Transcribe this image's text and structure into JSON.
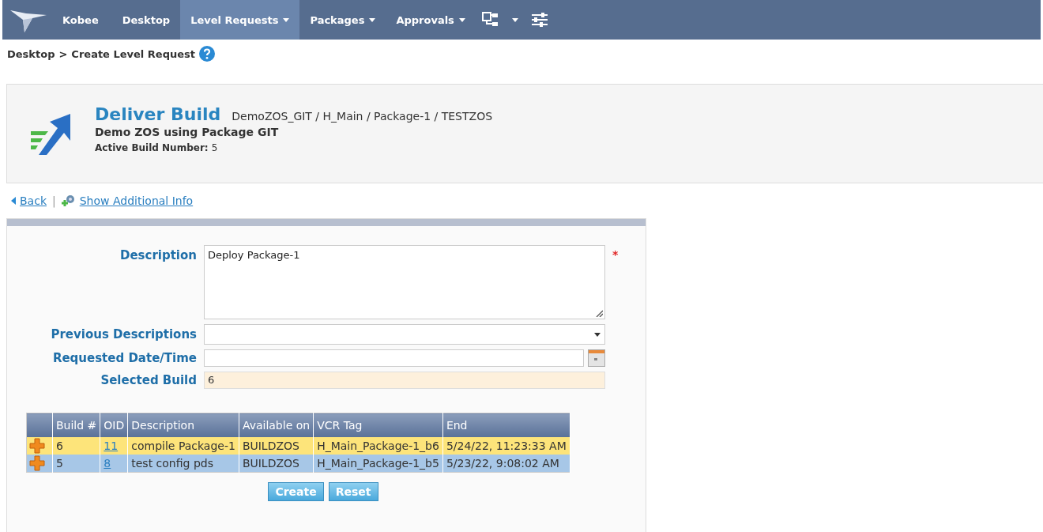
{
  "navbar": {
    "brand": "Kobee",
    "items": [
      {
        "label": "Desktop",
        "selected": false,
        "dropdown": false
      },
      {
        "label": "Level Requests",
        "selected": true,
        "dropdown": true
      },
      {
        "label": "Packages",
        "selected": false,
        "dropdown": true
      },
      {
        "label": "Approvals",
        "selected": false,
        "dropdown": true
      }
    ]
  },
  "breadcrumb": [
    "Desktop",
    ">",
    "Create Level Request"
  ],
  "header": {
    "title": "Deliver Build",
    "path": "DemoZOS_GIT / H_Main / Package-1 / TESTZOS",
    "subtitle": "Demo ZOS using Package GIT",
    "active_label": "Active Build Number:",
    "active_value": "5"
  },
  "links": {
    "back": "Back",
    "separator": "|",
    "additional": "Show Additional Info"
  },
  "form": {
    "description": {
      "label": "Description",
      "value": "Deploy Package-1",
      "required_mark": "*"
    },
    "previous": {
      "label": "Previous Descriptions"
    },
    "requested": {
      "label": "Requested Date/Time"
    },
    "selected_build": {
      "label": "Selected Build",
      "value": "6"
    }
  },
  "table": {
    "columns": [
      "Build #",
      "OID",
      "Description",
      "Available on",
      "VCR Tag",
      "End"
    ],
    "rows": [
      {
        "build": "6",
        "oid": "11",
        "description": "compile Package-1",
        "available_on": "BUILDZOS",
        "vcr_tag": "H_Main_Package-1_b6",
        "end": "5/24/22, 11:23:33 AM",
        "selected": true
      },
      {
        "build": "5",
        "oid": "8",
        "description": "test config pds",
        "available_on": "BUILDZOS",
        "vcr_tag": "H_Main_Package-1_b5",
        "end": "5/23/22, 9:08:02 AM",
        "selected": false
      }
    ]
  },
  "buttons": [
    "Create",
    "Reset"
  ]
}
